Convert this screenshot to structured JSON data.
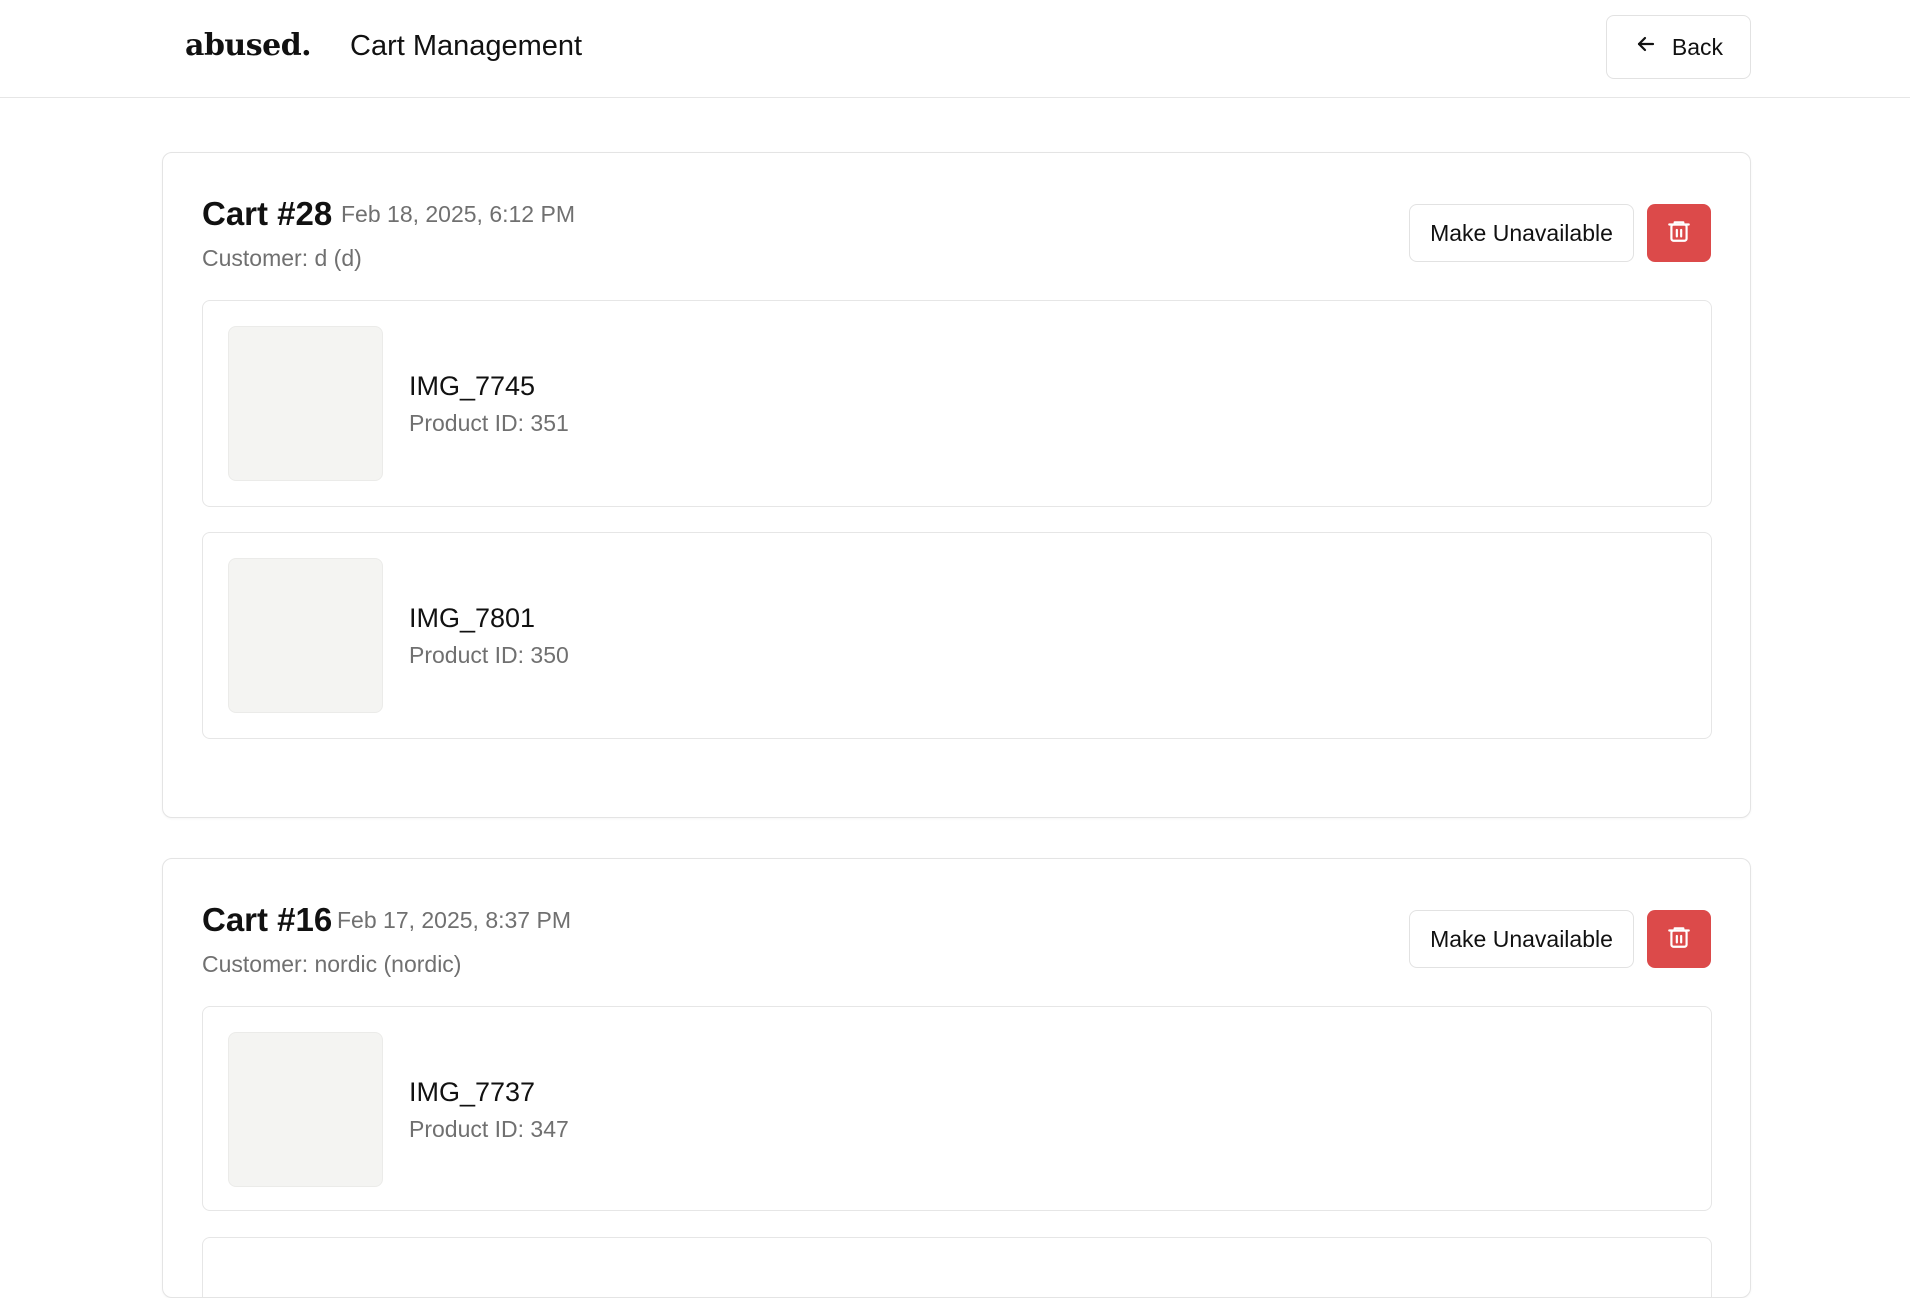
{
  "header": {
    "logo": "abused.",
    "title": "Cart Management",
    "back_label": "Back"
  },
  "carts": [
    {
      "title": "Cart #28",
      "date": "Feb 18, 2025, 6:12 PM",
      "customer": "Customer: d (d)",
      "make_unavailable_label": "Make Unavailable",
      "items": [
        {
          "name": "IMG_7745",
          "product_id": "Product ID: 351"
        },
        {
          "name": "IMG_7801",
          "product_id": "Product ID: 350"
        }
      ]
    },
    {
      "title": "Cart #16",
      "date": "Feb 17, 2025, 8:37 PM",
      "customer": "Customer: nordic (nordic)",
      "make_unavailable_label": "Make Unavailable",
      "items": [
        {
          "name": "IMG_7737",
          "product_id": "Product ID: 347"
        }
      ]
    }
  ],
  "icons": {
    "back": "arrow-left-icon",
    "delete": "trash-icon"
  },
  "colors": {
    "delete_button": "#dc4a4a",
    "muted_text": "#707070",
    "thumbnail_placeholder": "#f4f4f2"
  }
}
